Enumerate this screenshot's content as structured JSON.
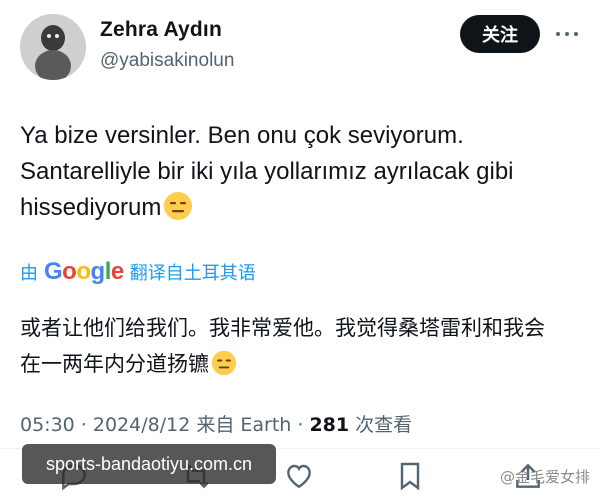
{
  "author": {
    "name": "Zehra Aydın",
    "handle": "@yabisakinolun"
  },
  "follow_label": "关注",
  "tweet": {
    "line1": "Ya bize versinler. Ben onu çok seviyorum.",
    "line2": "Santarelliyle bir iki yıla yollarımız ayrılacak gibi",
    "line3": "hissediyorum"
  },
  "translation": {
    "prefix": "由",
    "provider": "Google",
    "suffix": "翻译自土耳其语",
    "line1": "或者让他们给我们。我非常爱他。我觉得桑塔雷利和我会",
    "line2": "在一两年内分道扬镳"
  },
  "meta": {
    "time_date": "05:30 · 2024/8/12 来自 Earth ·",
    "view_count": "281",
    "view_label": "次查看"
  },
  "watermarks": {
    "site": "sports-bandaotiyu.com.cn",
    "credit": "@金毛爱女排"
  },
  "icons": [
    "more-icon",
    "expressionless-emoji",
    "reply-icon",
    "retweet-icon",
    "like-icon",
    "bookmark-icon",
    "share-icon"
  ],
  "colors": {
    "text": "#0f1419",
    "secondary": "#536471",
    "link": "#1d9bf0",
    "button_bg": "#0f1419"
  }
}
